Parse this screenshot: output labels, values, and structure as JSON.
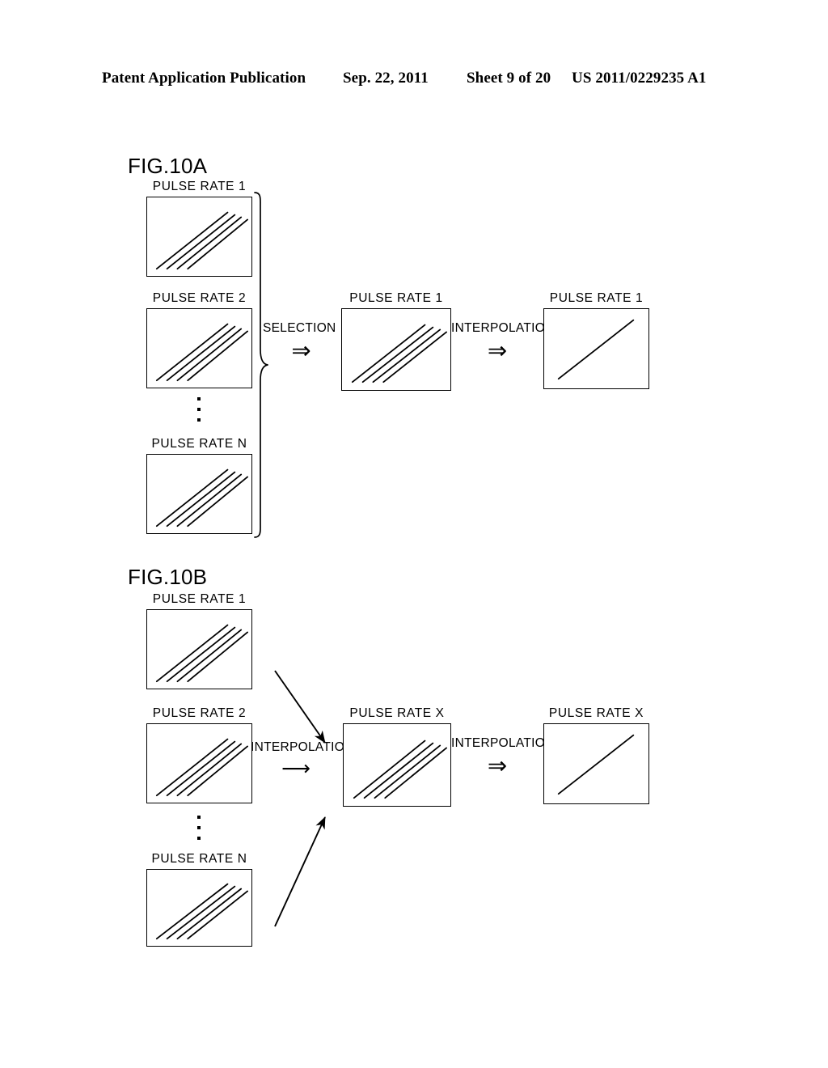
{
  "header": {
    "publication": "Patent Application Publication",
    "date": "Sep. 22, 2011",
    "sheet": "Sheet 9 of 20",
    "patent_number": "US 2011/0229235 A1"
  },
  "figures": [
    {
      "id": "fig-10a",
      "title": "FIG.10A",
      "inputs": [
        {
          "label": "PULSE RATE 1",
          "lines": 4
        },
        {
          "label": "PULSE RATE 2",
          "lines": 4
        },
        {
          "label": "PULSE RATE N",
          "lines": 4
        }
      ],
      "ellipsis": "vertical-ellipsis",
      "brace": "right-curly-brace",
      "steps": [
        {
          "label": "SELECTION",
          "arrow": "⇒"
        },
        {
          "label": "INTERPOLATION",
          "arrow": "⇒"
        }
      ],
      "outputs": [
        {
          "label": "PULSE RATE 1",
          "lines": 4
        },
        {
          "label": "PULSE RATE 1",
          "lines": 1
        }
      ]
    },
    {
      "id": "fig-10b",
      "title": "FIG.10B",
      "inputs": [
        {
          "label": "PULSE RATE 1",
          "lines": 4
        },
        {
          "label": "PULSE RATE 2",
          "lines": 4
        },
        {
          "label": "PULSE RATE N",
          "lines": 4
        }
      ],
      "ellipsis": "vertical-ellipsis",
      "steps": [
        {
          "label": "INTERPOLATION",
          "arrow": "⟶"
        },
        {
          "label": "INTERPOLATION",
          "arrow": "⇒"
        }
      ],
      "outputs": [
        {
          "label": "PULSE RATE X",
          "lines": 4
        },
        {
          "label": "PULSE RATE X",
          "lines": 1
        }
      ],
      "connectors": [
        "diagonal-arrow-from-pulse-rate-1",
        "diagonal-arrow-from-pulse-rate-n"
      ]
    }
  ],
  "colors": {
    "ink": "#000000",
    "paper": "#ffffff"
  }
}
